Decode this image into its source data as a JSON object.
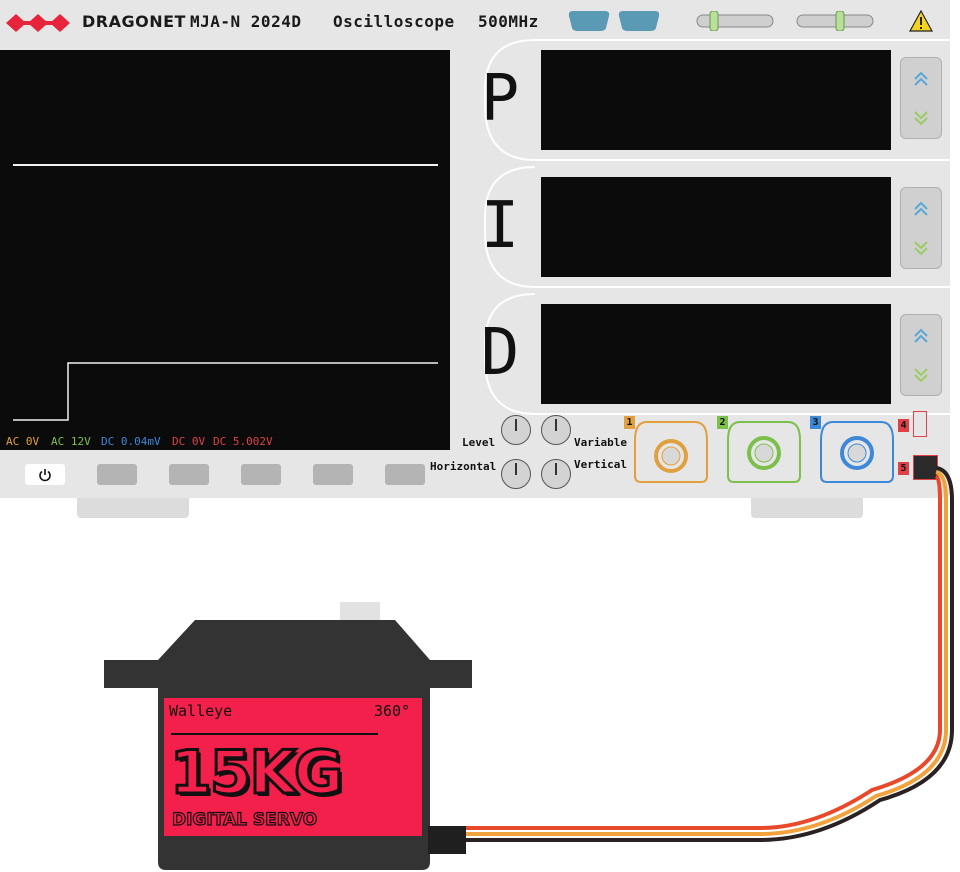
{
  "brand": {
    "name": "DRAGONET",
    "model": "MJA-N 2024D",
    "product": "Oscilloscope",
    "bandwidth": "500MHz"
  },
  "colors": {
    "brand_red": "#e8243c",
    "ch1": "#e0a040",
    "ch2": "#7cc04c",
    "ch3": "#3d88d8",
    "ch4": "#e04048",
    "servo_label": "#f4204c",
    "servo_body": "#333333",
    "screen": "#0b0b0b"
  },
  "screen": {
    "readouts": [
      {
        "coupling": "AC",
        "value": "0V",
        "color": "#e0a040"
      },
      {
        "coupling": "AC",
        "value": "12V",
        "color": "#7cc04c"
      },
      {
        "coupling": "DC",
        "value": "0.04mV",
        "color": "#3d88d8"
      },
      {
        "coupling": "DC",
        "value": "0V",
        "color": "#e04048"
      },
      {
        "coupling": "DC",
        "value": "5.002V",
        "color": "#e04048"
      }
    ]
  },
  "pid": {
    "p_label": "P",
    "i_label": "I",
    "d_label": "D"
  },
  "controls": {
    "level_label": "Level",
    "variable_label": "Variable",
    "horizontal_label": "Horizontal",
    "vertical_label": "Vertical"
  },
  "channels": {
    "ch1": "1",
    "ch2": "2",
    "ch3": "3",
    "ch4": "4",
    "ch5": "5"
  },
  "icons": {
    "power": "power-icon",
    "warning": "warning-icon",
    "up": "chevron-up-icon",
    "down": "chevron-down-icon"
  },
  "servo": {
    "brand": "Walleye",
    "rotation": "360°",
    "torque": "15KG",
    "type": "DIGITAL SERVO"
  }
}
